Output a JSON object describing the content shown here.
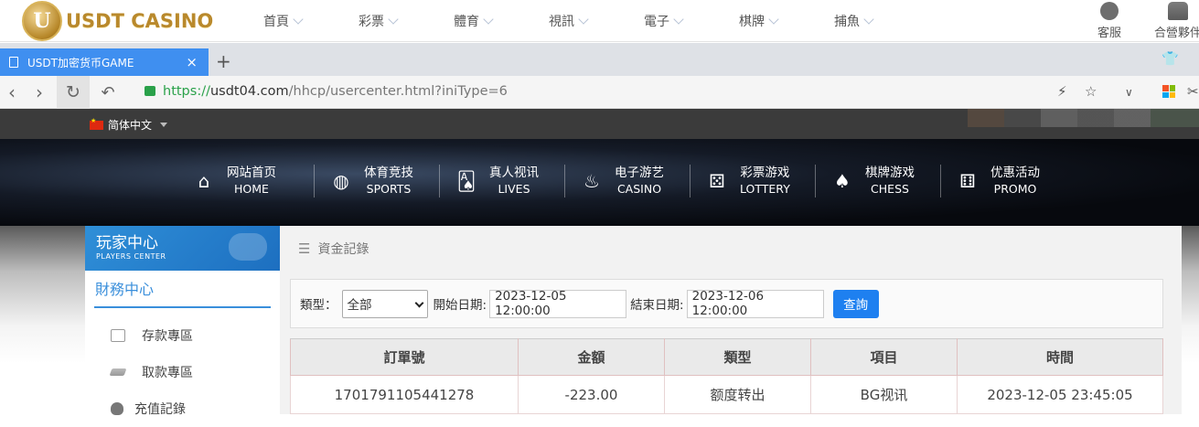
{
  "site_header": {
    "logo_letter": "U",
    "logo_text": "USDT CASINO",
    "nav": [
      "首頁",
      "彩票",
      "體育",
      "視訊",
      "電子",
      "棋牌",
      "捕魚"
    ],
    "service_label": "客服",
    "partner_label": "合營夥伴"
  },
  "browser": {
    "tab_title": "USDT加密货币GAME",
    "tab_close": "×",
    "new_tab": "+",
    "url_scheme": "https://",
    "url_host": "usdt04.com",
    "url_path": "/hhcp/usercenter.html?iniType=6"
  },
  "langbar": {
    "language": "简体中文"
  },
  "hero_nav": [
    {
      "icon": "home-icon",
      "glyph": "⌂",
      "zh": "网站首页",
      "en": "HOME"
    },
    {
      "icon": "sports-ball-icon",
      "glyph": "◍",
      "zh": "体育竞技",
      "en": "SPORTS"
    },
    {
      "icon": "cards-icon",
      "glyph": "🂡",
      "zh": "真人视讯",
      "en": "LIVES"
    },
    {
      "icon": "slot-icon",
      "glyph": "♨",
      "zh": "电子游艺",
      "en": "CASINO"
    },
    {
      "icon": "dice-icon",
      "glyph": "⚄",
      "zh": "彩票游戏",
      "en": "LOTTERY"
    },
    {
      "icon": "spade-icon",
      "glyph": "♠",
      "zh": "棋牌游戏",
      "en": "CHESS"
    },
    {
      "icon": "gift-icon",
      "glyph": "⚅",
      "zh": "优惠活动",
      "en": "PROMO"
    }
  ],
  "side": {
    "title_zh": "玩家中心",
    "title_en": "PLAYERS CENTER",
    "section": "財務中心",
    "items": [
      "存款專區",
      "取款專區",
      "充值記錄"
    ]
  },
  "main": {
    "heading": "資金記錄",
    "filter": {
      "type_label": "類型：",
      "type_value": "全部",
      "start_label": "開始日期:",
      "start_value": "2023-12-05 12:00:00",
      "end_label": "結束日期:",
      "end_value": "2023-12-06 12:00:00",
      "query_button": "查詢"
    },
    "table": {
      "headers": [
        "訂單號",
        "金額",
        "類型",
        "項目",
        "時間"
      ],
      "rows": [
        [
          "1701791105441278",
          "-223.00",
          "额度转出",
          "BG视讯",
          "2023-12-05 23:45:05"
        ]
      ]
    }
  },
  "colors": {
    "accent": "#1e80f0",
    "side_header": "#2f8fd8",
    "logo_gold": "#b9892c",
    "tab_blue": "#3f8ff0",
    "url_green": "#2aa14a"
  }
}
